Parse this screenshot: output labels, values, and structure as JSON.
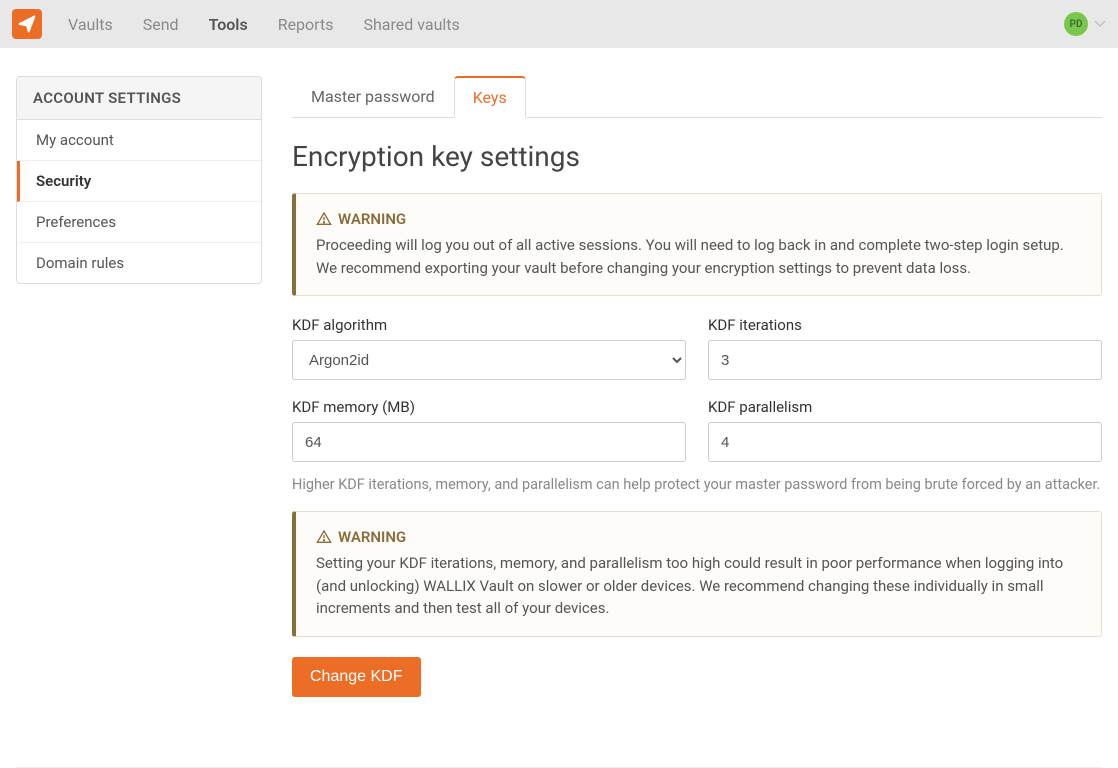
{
  "colors": {
    "accent": "#ec6e26",
    "avatar_bg": "#7ac74f",
    "warning": "#8a6d3b"
  },
  "topnav": {
    "items": [
      "Vaults",
      "Send",
      "Tools",
      "Reports",
      "Shared vaults"
    ],
    "active_index": 2
  },
  "user": {
    "initials": "PD"
  },
  "sidebar": {
    "title": "ACCOUNT SETTINGS",
    "items": [
      "My account",
      "Security",
      "Preferences",
      "Domain rules"
    ],
    "active_index": 1
  },
  "tabs": {
    "items": [
      "Master password",
      "Keys"
    ],
    "active_index": 1
  },
  "page_title": "Encryption key settings",
  "warning1": {
    "title": "WARNING",
    "body": "Proceeding will log you out of all active sessions. You will need to log back in and complete two-step login setup. We recommend exporting your vault before changing your encryption settings to prevent data loss."
  },
  "form": {
    "kdf_algorithm": {
      "label": "KDF algorithm",
      "value": "Argon2id",
      "options": [
        "Argon2id"
      ]
    },
    "kdf_iterations": {
      "label": "KDF iterations",
      "value": "3"
    },
    "kdf_memory": {
      "label": "KDF memory (MB)",
      "value": "64"
    },
    "kdf_parallelism": {
      "label": "KDF parallelism",
      "value": "4"
    }
  },
  "hint": "Higher KDF iterations, memory, and parallelism can help protect your master password from being brute forced by an attacker.",
  "warning2": {
    "title": "WARNING",
    "body": "Setting your KDF iterations, memory, and parallelism too high could result in poor performance when logging into (and unlocking) WALLIX Vault on slower or older devices. We recommend changing these individually in small increments and then test all of your devices."
  },
  "submit_label": "Change KDF"
}
